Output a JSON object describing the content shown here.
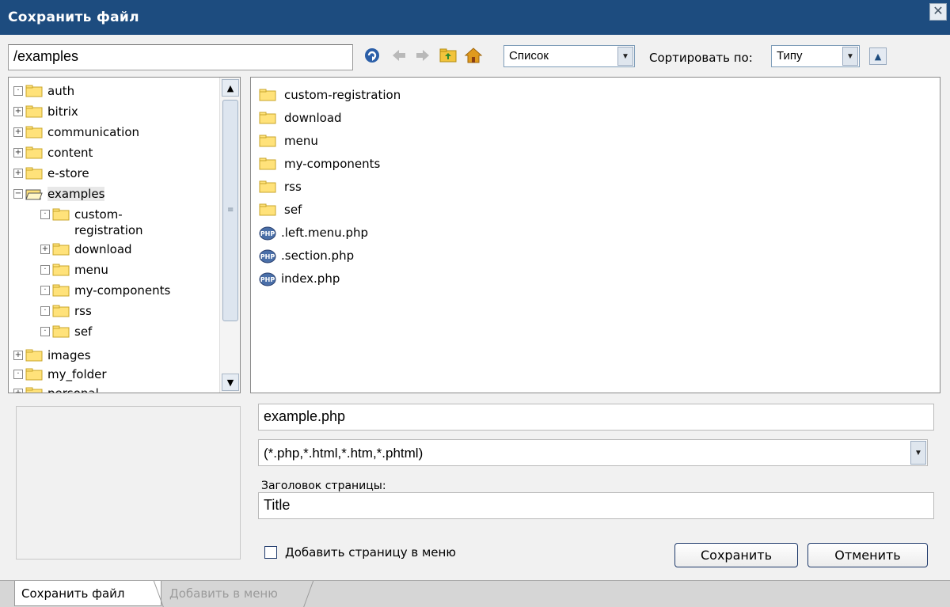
{
  "window": {
    "title": "Сохранить файл"
  },
  "toolbar": {
    "path_value": "/examples",
    "view_mode": "Список",
    "sort_label": "Сортировать по:",
    "sort_value": "Типу"
  },
  "tree": {
    "items": [
      {
        "label": "auth",
        "expander": "·"
      },
      {
        "label": "bitrix",
        "expander": "+"
      },
      {
        "label": "communication",
        "expander": "+"
      },
      {
        "label": "content",
        "expander": "+"
      },
      {
        "label": "e-store",
        "expander": "+"
      },
      {
        "label": "examples",
        "expander": "−"
      },
      {
        "label": "custom-registration",
        "expander": "·"
      },
      {
        "label": "download",
        "expander": "+"
      },
      {
        "label": "menu",
        "expander": "·"
      },
      {
        "label": "my-components",
        "expander": "·"
      },
      {
        "label": "rss",
        "expander": "·"
      },
      {
        "label": "sef",
        "expander": "·"
      },
      {
        "label": "images",
        "expander": "+"
      },
      {
        "label": "my_folder",
        "expander": "·"
      },
      {
        "label": "personal",
        "expander": "+"
      }
    ]
  },
  "files": {
    "items": [
      {
        "label": "custom-registration",
        "type": "folder"
      },
      {
        "label": "download",
        "type": "folder"
      },
      {
        "label": "menu",
        "type": "folder"
      },
      {
        "label": "my-components",
        "type": "folder"
      },
      {
        "label": "rss",
        "type": "folder"
      },
      {
        "label": "sef",
        "type": "folder"
      },
      {
        "label": ".left.menu.php",
        "type": "php"
      },
      {
        "label": ".section.php",
        "type": "php"
      },
      {
        "label": "index.php",
        "type": "php"
      }
    ]
  },
  "form": {
    "filename_value": "example.php",
    "filter_value": "(*.php,*.html,*.htm,*.phtml)",
    "page_title_label": "Заголовок страницы:",
    "page_title_value": "Title",
    "add_to_menu_label": "Добавить страницу в меню",
    "save_label": "Сохранить",
    "cancel_label": "Отменить"
  },
  "tabs": [
    {
      "label": "Сохранить файл",
      "active": true
    },
    {
      "label": "Добавить в меню",
      "active": false
    }
  ],
  "colors": {
    "titlebar": "#1d4c7f",
    "folder_fill": "#ffe27a"
  }
}
